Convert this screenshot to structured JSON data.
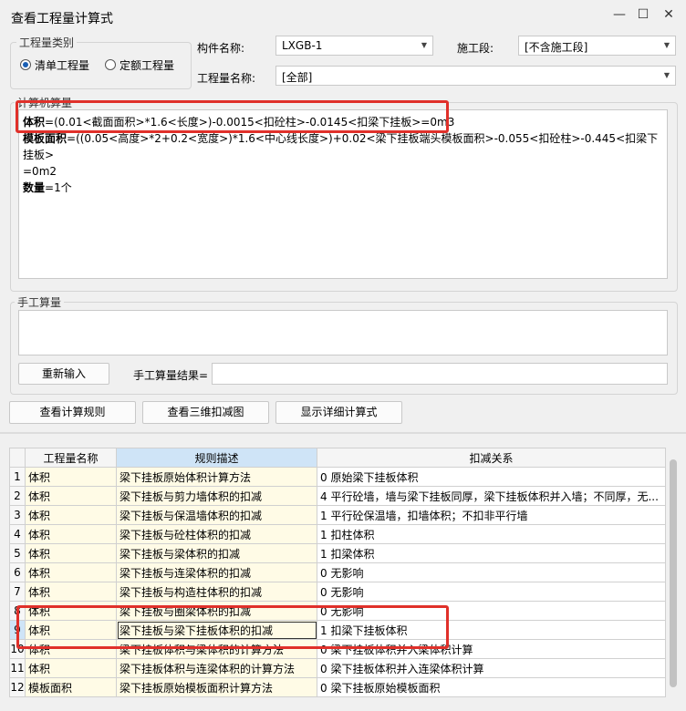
{
  "window": {
    "title": "查看工程量计算式",
    "minimize": "—",
    "maximize": "☐",
    "close": "✕"
  },
  "quantity_type": {
    "legend": "工程量类别",
    "option_list": "清单工程量",
    "option_quota": "定额工程量"
  },
  "component_label": "构件名称:",
  "component_value": "LXGB-1",
  "stage_label": "施工段:",
  "stage_value": "[不含施工段]",
  "qty_name_label": "工程量名称:",
  "qty_name_value": "[全部]",
  "machine_calc": {
    "legend": "计算机算量",
    "line1_key": "体积",
    "line1_val": "=(0.01<截面面积>*1.6<长度>)-0.0015<扣砼柱>-0.0145<扣梁下挂板>=0m3",
    "line2_key": "模板面积",
    "line2_val": "=((0.05<高度>*2+0.2<宽度>)*1.6<中心线长度>)+0.02<梁下挂板端头模板面积>-0.055<扣砼柱>-0.445<扣梁下挂板>",
    "line2_cont": "=0m2",
    "line3_key": "数量",
    "line3_val": "=1个"
  },
  "manual_calc": {
    "legend": "手工算量",
    "reenter_button": "重新输入",
    "result_label": "手工算量结果="
  },
  "buttons": {
    "view_rules": "查看计算规则",
    "view_3d": "查看三维扣减图",
    "show_detail": "显示详细计算式"
  },
  "table": {
    "headers": [
      "工程量名称",
      "规则描述",
      "扣减关系"
    ],
    "rows": [
      [
        "1",
        "体积",
        "梁下挂板原始体积计算方法",
        "0 原始梁下挂板体积"
      ],
      [
        "2",
        "体积",
        "梁下挂板与剪力墙体积的扣减",
        "4 平行砼墙，墙与梁下挂板同厚，梁下挂板体积并入墙；不同厚，无..."
      ],
      [
        "3",
        "体积",
        "梁下挂板与保温墙体积的扣减",
        "1 平行砼保温墙，扣墙体积；不扣非平行墙"
      ],
      [
        "4",
        "体积",
        "梁下挂板与砼柱体积的扣减",
        "1 扣柱体积"
      ],
      [
        "5",
        "体积",
        "梁下挂板与梁体积的扣减",
        "1 扣梁体积"
      ],
      [
        "6",
        "体积",
        "梁下挂板与连梁体积的扣减",
        "0  无影响"
      ],
      [
        "7",
        "体积",
        "梁下挂板与构造柱体积的扣减",
        "0  无影响"
      ],
      [
        "8",
        "体积",
        "梁下挂板与圈梁体积的扣减",
        "0  无影响"
      ],
      [
        "9",
        "体积",
        "梁下挂板与梁下挂板体积的扣减",
        "1 扣梁下挂板体积"
      ],
      [
        "10",
        "体积",
        "梁下挂板体积与梁体积的计算方法",
        "0 梁下挂板体积并入梁体积计算"
      ],
      [
        "11",
        "体积",
        "梁下挂板体积与连梁体积的计算方法",
        "0 梁下挂板体积并入连梁体积计算"
      ],
      [
        "12",
        "模板面积",
        "梁下挂板原始模板面积计算方法",
        "0 梁下挂板原始模板面积"
      ]
    ]
  },
  "colors": {
    "highlight_red": "#e0302a",
    "rule_header": "#cfe4f7",
    "cell_yellow": "#fffbe6"
  }
}
